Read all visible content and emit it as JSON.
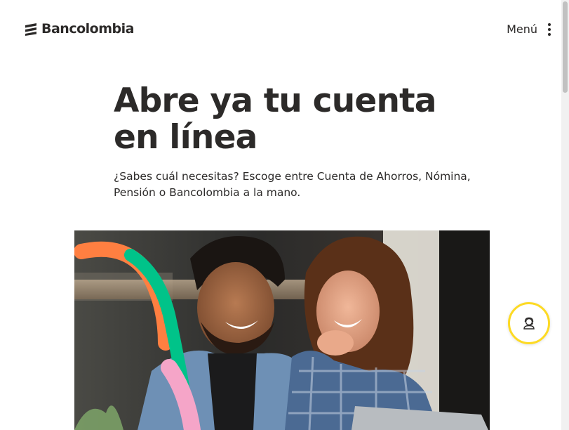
{
  "header": {
    "logo_text": "Bancolombia",
    "menu_label": "Menú",
    "menu_icon": "kebab-vertical-icon"
  },
  "hero": {
    "title_line1": "Abre ya tu cuenta",
    "title_line2": "en línea",
    "subtitle_line1": "¿Sabes cuál necesitas? Escoge entre Cuenta de Ahorros, Nómina,",
    "subtitle_line2": "Pensión o Bancolombia a la mano."
  },
  "chat": {
    "icon": "support-agent-icon"
  },
  "colors": {
    "text": "#2c2a29",
    "brand_yellow": "#fdda24",
    "accent_orange": "#ff7f41",
    "accent_green": "#00c389",
    "accent_pink": "#f5a5c8"
  }
}
